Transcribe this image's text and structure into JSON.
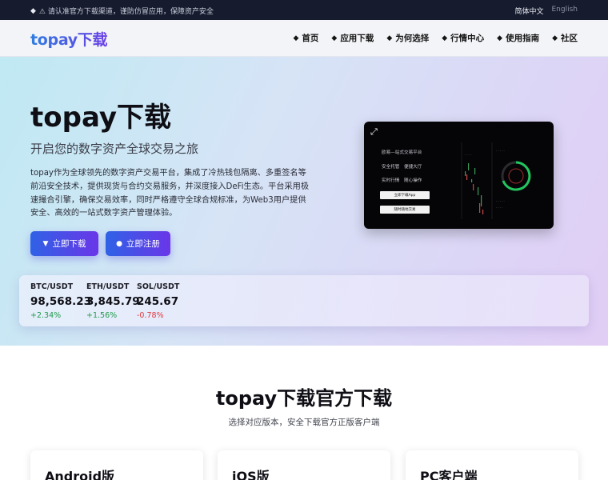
{
  "topbar": {
    "notice_icon": "diamond-icon",
    "notice": "⚠ 请认准官方下载渠道，谨防仿冒应用，保障资产安全",
    "lang_zh": "简体中文",
    "lang_en": "English"
  },
  "header": {
    "logo": "topay下载",
    "nav": [
      {
        "label": "首页",
        "icon": "diamond-icon"
      },
      {
        "label": "应用下载",
        "icon": "diamond-icon"
      },
      {
        "label": "为何选择",
        "icon": "diamond-icon"
      },
      {
        "label": "行情中心",
        "icon": "diamond-icon"
      },
      {
        "label": "使用指南",
        "icon": "diamond-icon"
      },
      {
        "label": "社区",
        "icon": "diamond-icon"
      }
    ]
  },
  "hero": {
    "title": "topay下载",
    "subtitle": "开启您的数字资产全球交易之旅",
    "description": "topay作为全球领先的数字资产交易平台，集成了冷热钱包隔离、多重签名等前沿安全技术，提供现货与合约交易服务，并深度接入DeFi生态。平台采用极速撮合引擎，确保交易效率，同时严格遵守全球合规标准，为Web3用户提供安全、高效的一站式数字资产管理体验。",
    "download_button": "立即下载",
    "register_button": "立即注册",
    "mockup": {
      "line1": "欧易—站式交易平台",
      "line2": "安全托管　便捷大厅",
      "line3": "实时行情　随心操作",
      "button1": "立即下载App",
      "button2": "随时随地交易",
      "accent": "#22c55e"
    }
  },
  "ticker": [
    {
      "pair": "BTC/USDT",
      "price": "98,568.23",
      "change": "+2.34%",
      "direction": "up"
    },
    {
      "pair": "ETH/USDT",
      "price": "3,845.79",
      "change": "+1.56%",
      "direction": "up"
    },
    {
      "pair": "SOL/USDT",
      "price": "245.67",
      "change": "-0.78%",
      "direction": "down"
    }
  ],
  "download": {
    "title": "topay下载官方下载",
    "subtitle": "选择对应版本，安全下载官方正版客户端",
    "cards": [
      {
        "title": "Android版"
      },
      {
        "title": "iOS版"
      },
      {
        "title": "PC客户端"
      }
    ]
  },
  "colors": {
    "brand_blue": "#2f7de1",
    "brand_purple": "#6a3fe6",
    "up": "#1f9a4b",
    "down": "#e0393e"
  }
}
